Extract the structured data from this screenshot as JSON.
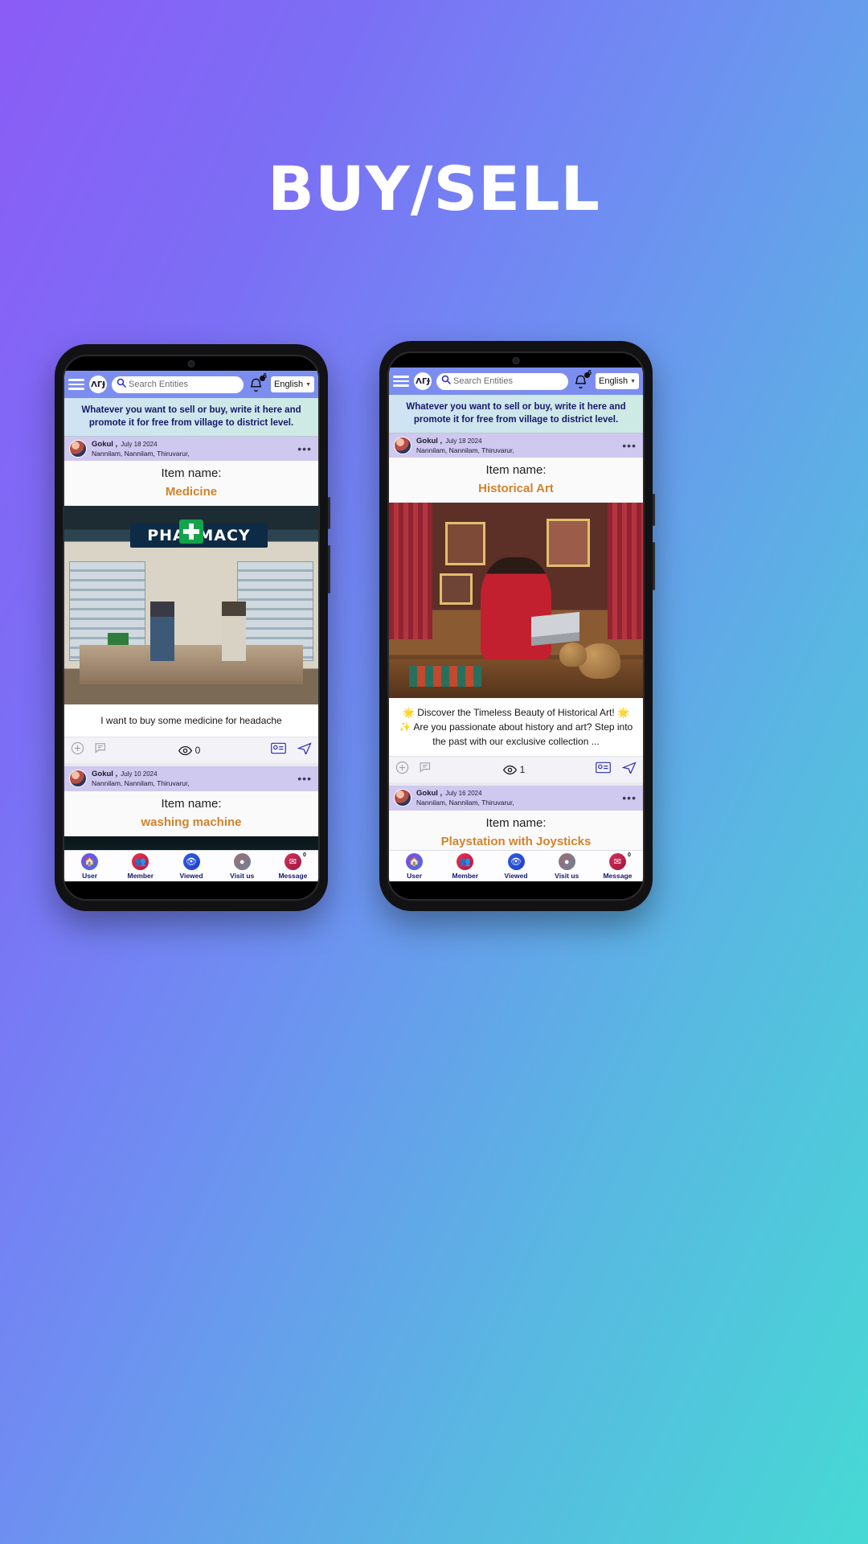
{
  "page": {
    "title": "BUY/SELL",
    "background_gradient_from": "#8b5cf6",
    "background_gradient_to": "#46d9d4",
    "title_color": "#ffffff"
  },
  "app": {
    "header": {
      "menu_icon": "hamburger-menu-icon",
      "logo_text": "ɅГɈ",
      "search_placeholder": "Search Entities",
      "search_value": "",
      "search_icon": "search-icon",
      "notification_icon": "bell-icon",
      "notification_count": "6",
      "language_value": "English",
      "language_caret": "⌄",
      "bar_color": "#7b8ef0"
    },
    "banner": {
      "line1": "Whatever you want to sell or buy, write it here and",
      "line2": "promote it for free from village to district level.",
      "text_color": "#16186b"
    },
    "bottom_nav": [
      {
        "label": "User",
        "icon": "home-user-icon",
        "badge": ""
      },
      {
        "label": "Member",
        "icon": "add-member-icon",
        "badge": ""
      },
      {
        "label": "Viewed",
        "icon": "eye-viewed-icon",
        "badge": ""
      },
      {
        "label": "Visit us",
        "icon": "location-pin-icon",
        "badge": ""
      },
      {
        "label": "Message",
        "icon": "message-icon",
        "badge": "0"
      }
    ],
    "post_ui": {
      "item_name_label": "Item name:",
      "more_options": "•••",
      "add_icon": "plus-circle-icon",
      "comment_icon": "comment-question-icon",
      "views_icon": "eye-icon",
      "contact_icon": "contact-card-icon",
      "share_icon": "send-share-icon",
      "item_value_color": "#d2822c"
    }
  },
  "phones": [
    {
      "name": "left-phone",
      "posts": [
        {
          "author": "Gokul ,",
          "date": "July 18 2024",
          "location": "Nannilam,  Nannilam,  Thiruvarur,",
          "item_name": "Medicine",
          "image": "pharmacy-store-photo",
          "description": "I want to buy some medicine for headache",
          "views": "0"
        },
        {
          "author": "Gokul ,",
          "date": "July 10 2024",
          "location": "Nannilam,  Nannilam,  Thiruvarur,",
          "item_name": "washing machine",
          "image": "washing-machine-photo",
          "description": "",
          "views": ""
        }
      ]
    },
    {
      "name": "right-phone",
      "posts": [
        {
          "author": "Gokul ,",
          "date": "July 18 2024",
          "location": "Nannilam,  Nannilam,  Thiruvarur,",
          "item_name": "Historical Art",
          "image": "historical-art-photo",
          "description": "🌟 Discover the Timeless Beauty of Historical Art! 🌟 ✨ Are you passionate about history and art? Step into the past with our exclusive collection ...",
          "views": "1"
        },
        {
          "author": "Gokul ,",
          "date": "July 16 2024",
          "location": "Nannilam,  Nannilam,  Thiruvarur,",
          "item_name": "Playstation with Joysticks",
          "image": "",
          "description": "",
          "views": ""
        }
      ]
    }
  ]
}
